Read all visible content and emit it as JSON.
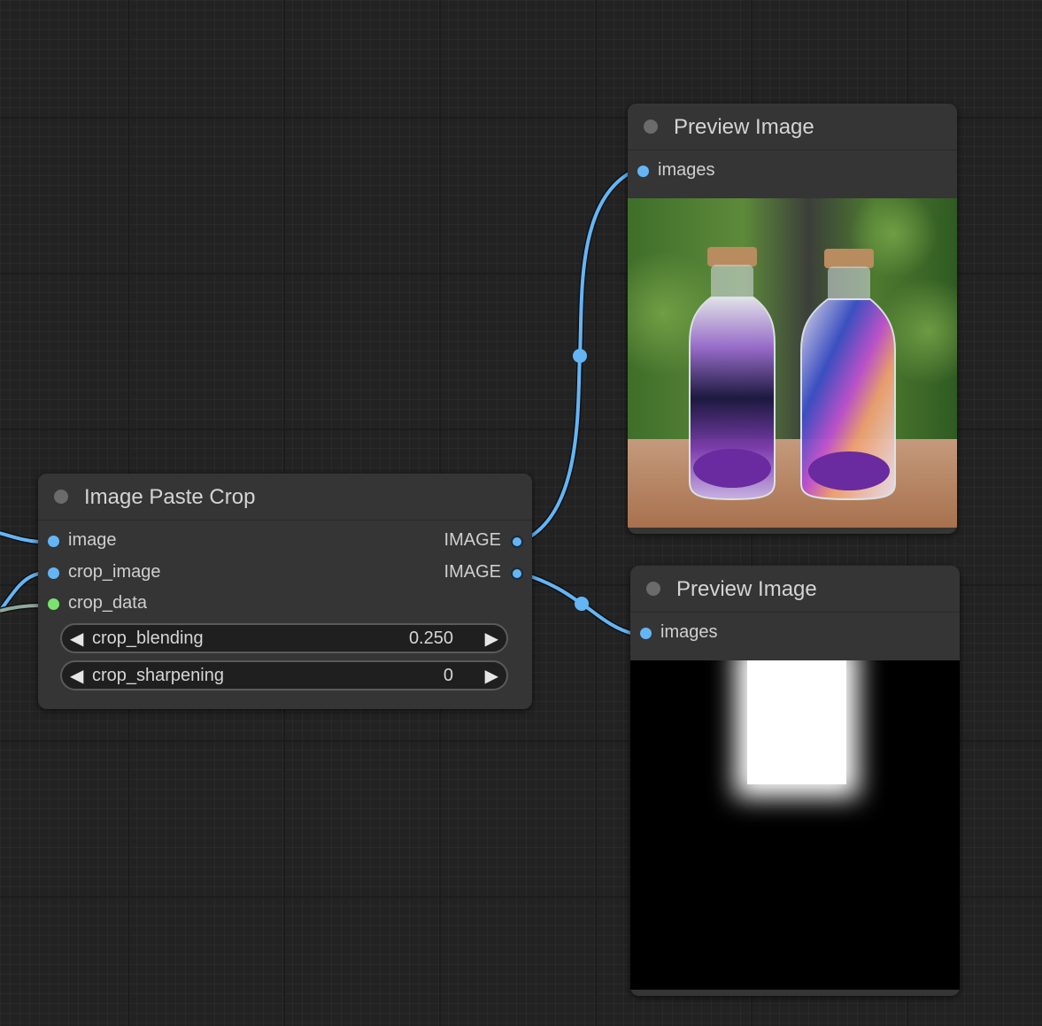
{
  "nodes": {
    "paste_crop": {
      "title": "Image Paste Crop",
      "inputs": [
        {
          "label": "image",
          "color": "#64b5f6"
        },
        {
          "label": "crop_image",
          "color": "#64b5f6"
        },
        {
          "label": "crop_data",
          "color": "#7ae36e"
        }
      ],
      "outputs": [
        {
          "label": "IMAGE"
        },
        {
          "label": "IMAGE"
        }
      ],
      "widgets": [
        {
          "label": "crop_blending",
          "value": "0.250"
        },
        {
          "label": "crop_sharpening",
          "value": "0"
        }
      ]
    },
    "preview_top": {
      "title": "Preview Image",
      "input_label": "images",
      "image_desc": "two glass bottles with galaxy contents on a wooden table"
    },
    "preview_bottom": {
      "title": "Preview Image",
      "input_label": "images",
      "image_desc": "black mask with blurred white rectangle"
    }
  },
  "icons": {
    "widget_decrement": "◀",
    "widget_increment": "▶"
  },
  "colors": {
    "canvas_bg": "#222222",
    "node_bg": "#353535",
    "image_link": "#64b5f6",
    "crop_data_link": "#8fa89a"
  }
}
